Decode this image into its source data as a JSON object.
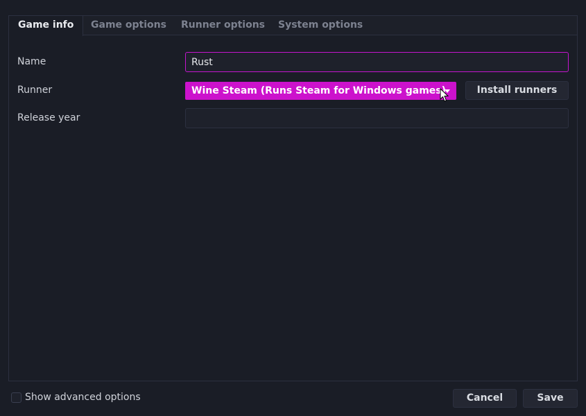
{
  "tabs": [
    {
      "label": "Game info",
      "active": true
    },
    {
      "label": "Game options",
      "active": false
    },
    {
      "label": "Runner options",
      "active": false
    },
    {
      "label": "System options",
      "active": false
    }
  ],
  "form": {
    "name_label": "Name",
    "name_value": "Rust",
    "runner_label": "Runner",
    "runner_selected": "Wine Steam (Runs Steam for Windows games)",
    "install_runners_label": "Install runners",
    "release_year_label": "Release year",
    "release_year_value": ""
  },
  "footer": {
    "show_advanced_label": "Show advanced options",
    "show_advanced_checked": false,
    "cancel_label": "Cancel",
    "save_label": "Save"
  },
  "colors": {
    "accent": "#cc12cc",
    "background": "#1a1d26",
    "border": "#2c3040"
  },
  "icons": {
    "combo_arrow": "triangle-down",
    "pointer": "mouse-cursor"
  }
}
